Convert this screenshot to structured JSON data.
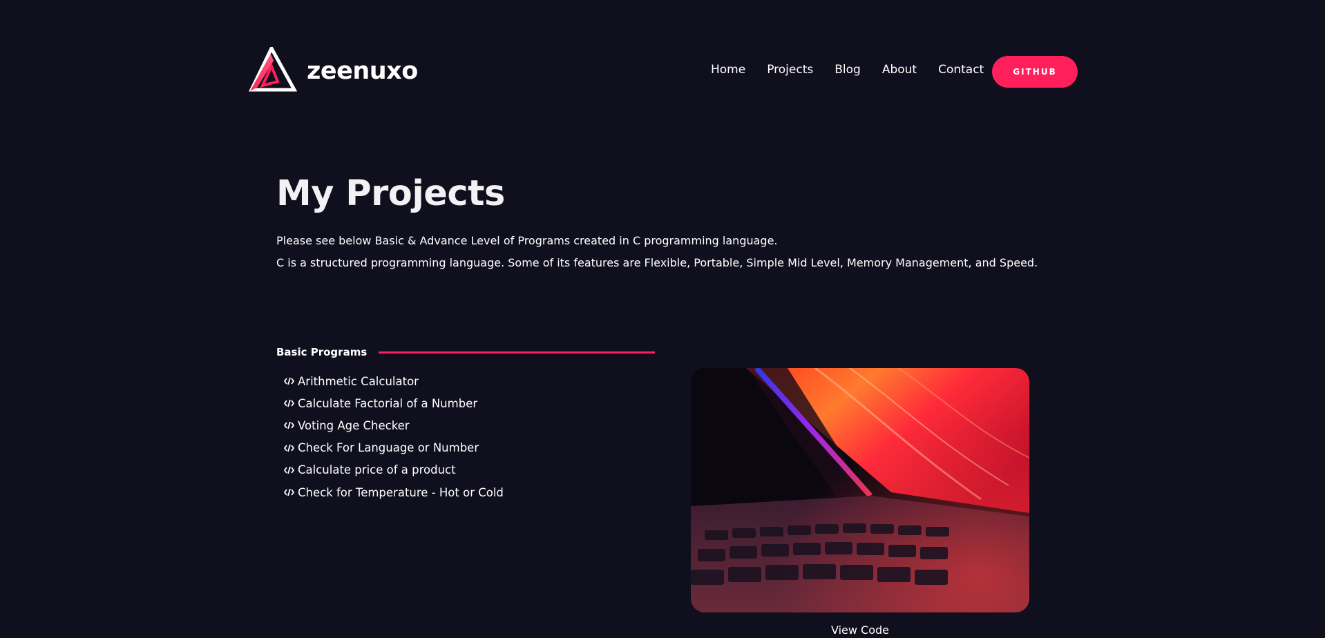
{
  "brand": {
    "name": "zeenuxo",
    "accent": "#ff1f5a",
    "background": "#100f1d"
  },
  "nav": {
    "items": [
      "Home",
      "Projects",
      "Blog",
      "About",
      "Contact"
    ],
    "github_label": "GITHUB"
  },
  "hero": {
    "title": "My Projects",
    "lines": [
      "Please see below Basic & Advance Level of Programs created in C programming language.",
      "C is a structured programming language. Some of its features are Flexible, Portable, Simple Mid Level, Memory Management, and Speed."
    ]
  },
  "section": {
    "title": "Basic Programs",
    "item_icon": "code-icon",
    "items": [
      "Arithmetic Calculator",
      "Calculate Factorial of a Number",
      "Voting Age Checker",
      "Check For Language or Number",
      "Calculate price of a product",
      "Check for Temperature - Hot or Cold"
    ]
  },
  "project": {
    "link_label": "View Code"
  }
}
